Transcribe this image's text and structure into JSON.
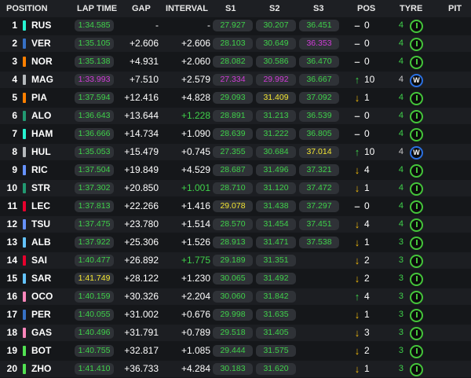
{
  "headers": {
    "position": "POSITION",
    "lap_time": "LAP TIME",
    "gap": "GAP",
    "interval": "INTERVAL",
    "s1": "S1",
    "s2": "S2",
    "s3": "S3",
    "pos": "POS",
    "tyre": "TYRE",
    "pit": "PIT"
  },
  "colors": {
    "personal_best": "#3fd14a",
    "session_best": "#d13cd8",
    "slower": "#f2e532",
    "medium_tyre": "#44c43a",
    "inter_tyre": "#2a6fe0"
  },
  "rows": [
    {
      "pos": "1",
      "team_color": "#27f4d2",
      "code": "RUS",
      "lap": "1:34.585",
      "lap_c": "green",
      "gap": "-",
      "int": "-",
      "int_c": "white",
      "s1": "27.927",
      "s1_c": "green",
      "s2": "30.207",
      "s2_c": "green",
      "s3": "36.451",
      "s3_c": "green",
      "arrow": "–",
      "arrow_dir": "none",
      "posval": "0",
      "tyre_life": "4",
      "tyre_icon": "medium-tyre-icon",
      "tyre_label": ""
    },
    {
      "pos": "2",
      "team_color": "#3671c6",
      "code": "VER",
      "lap": "1:35.105",
      "lap_c": "green",
      "gap": "+2.606",
      "int": "+2.606",
      "int_c": "white",
      "s1": "28.103",
      "s1_c": "green",
      "s2": "30.649",
      "s2_c": "green",
      "s3": "36.353",
      "s3_c": "purple",
      "arrow": "–",
      "arrow_dir": "none",
      "posval": "0",
      "tyre_life": "4",
      "tyre_icon": "medium-tyre-icon",
      "tyre_label": ""
    },
    {
      "pos": "3",
      "team_color": "#ff8000",
      "code": "NOR",
      "lap": "1:35.138",
      "lap_c": "green",
      "gap": "+4.931",
      "int": "+2.060",
      "int_c": "white",
      "s1": "28.082",
      "s1_c": "green",
      "s2": "30.586",
      "s2_c": "green",
      "s3": "36.470",
      "s3_c": "green",
      "arrow": "–",
      "arrow_dir": "none",
      "posval": "0",
      "tyre_life": "4",
      "tyre_icon": "medium-tyre-icon",
      "tyre_label": ""
    },
    {
      "pos": "4",
      "team_color": "#b6babd",
      "code": "MAG",
      "lap": "1:33.993",
      "lap_c": "purple",
      "gap": "+7.510",
      "int": "+2.579",
      "int_c": "white",
      "s1": "27.334",
      "s1_c": "purple",
      "s2": "29.992",
      "s2_c": "purple",
      "s3": "36.667",
      "s3_c": "green",
      "arrow": "↑",
      "arrow_dir": "up",
      "posval": "10",
      "tyre_life": "4",
      "tyre_icon": "intermediate-tyre-icon",
      "tyre_label": "W"
    },
    {
      "pos": "5",
      "team_color": "#ff8000",
      "code": "PIA",
      "lap": "1:37.594",
      "lap_c": "green",
      "gap": "+12.416",
      "int": "+4.828",
      "int_c": "white",
      "s1": "29.093",
      "s1_c": "green",
      "s2": "31.409",
      "s2_c": "yellow",
      "s3": "37.092",
      "s3_c": "green",
      "arrow": "↓",
      "arrow_dir": "down",
      "posval": "1",
      "tyre_life": "4",
      "tyre_icon": "medium-tyre-icon",
      "tyre_label": ""
    },
    {
      "pos": "6",
      "team_color": "#229971",
      "code": "ALO",
      "lap": "1:36.643",
      "lap_c": "green",
      "gap": "+13.644",
      "int": "+1.228",
      "int_c": "green",
      "s1": "28.891",
      "s1_c": "green",
      "s2": "31.213",
      "s2_c": "green",
      "s3": "36.539",
      "s3_c": "green",
      "arrow": "–",
      "arrow_dir": "none",
      "posval": "0",
      "tyre_life": "4",
      "tyre_icon": "medium-tyre-icon",
      "tyre_label": ""
    },
    {
      "pos": "7",
      "team_color": "#27f4d2",
      "code": "HAM",
      "lap": "1:36.666",
      "lap_c": "green",
      "gap": "+14.734",
      "int": "+1.090",
      "int_c": "white",
      "s1": "28.639",
      "s1_c": "green",
      "s2": "31.222",
      "s2_c": "green",
      "s3": "36.805",
      "s3_c": "green",
      "arrow": "–",
      "arrow_dir": "none",
      "posval": "0",
      "tyre_life": "4",
      "tyre_icon": "medium-tyre-icon",
      "tyre_label": ""
    },
    {
      "pos": "8",
      "team_color": "#b6babd",
      "code": "HUL",
      "lap": "1:35.053",
      "lap_c": "green",
      "gap": "+15.479",
      "int": "+0.745",
      "int_c": "white",
      "s1": "27.355",
      "s1_c": "green",
      "s2": "30.684",
      "s2_c": "green",
      "s3": "37.014",
      "s3_c": "yellow",
      "arrow": "↑",
      "arrow_dir": "up",
      "posval": "10",
      "tyre_life": "4",
      "tyre_icon": "intermediate-tyre-icon",
      "tyre_label": "W"
    },
    {
      "pos": "9",
      "team_color": "#6692ff",
      "code": "RIC",
      "lap": "1:37.504",
      "lap_c": "green",
      "gap": "+19.849",
      "int": "+4.529",
      "int_c": "white",
      "s1": "28.687",
      "s1_c": "green",
      "s2": "31.496",
      "s2_c": "green",
      "s3": "37.321",
      "s3_c": "green",
      "arrow": "↓",
      "arrow_dir": "down",
      "posval": "4",
      "tyre_life": "4",
      "tyre_icon": "medium-tyre-icon",
      "tyre_label": ""
    },
    {
      "pos": "10",
      "team_color": "#229971",
      "code": "STR",
      "lap": "1:37.302",
      "lap_c": "green",
      "gap": "+20.850",
      "int": "+1.001",
      "int_c": "green",
      "s1": "28.710",
      "s1_c": "green",
      "s2": "31.120",
      "s2_c": "green",
      "s3": "37.472",
      "s3_c": "green",
      "arrow": "↓",
      "arrow_dir": "down",
      "posval": "1",
      "tyre_life": "4",
      "tyre_icon": "medium-tyre-icon",
      "tyre_label": ""
    },
    {
      "pos": "11",
      "team_color": "#e8002d",
      "code": "LEC",
      "lap": "1:37.813",
      "lap_c": "green",
      "gap": "+22.266",
      "int": "+1.416",
      "int_c": "white",
      "s1": "29.078",
      "s1_c": "yellow",
      "s2": "31.438",
      "s2_c": "green",
      "s3": "37.297",
      "s3_c": "green",
      "arrow": "–",
      "arrow_dir": "none",
      "posval": "0",
      "tyre_life": "4",
      "tyre_icon": "medium-tyre-icon",
      "tyre_label": ""
    },
    {
      "pos": "12",
      "team_color": "#6692ff",
      "code": "TSU",
      "lap": "1:37.475",
      "lap_c": "green",
      "gap": "+23.780",
      "int": "+1.514",
      "int_c": "white",
      "s1": "28.570",
      "s1_c": "green",
      "s2": "31.454",
      "s2_c": "green",
      "s3": "37.451",
      "s3_c": "green",
      "arrow": "↓",
      "arrow_dir": "down",
      "posval": "4",
      "tyre_life": "4",
      "tyre_icon": "medium-tyre-icon",
      "tyre_label": ""
    },
    {
      "pos": "13",
      "team_color": "#64c4ff",
      "code": "ALB",
      "lap": "1:37.922",
      "lap_c": "green",
      "gap": "+25.306",
      "int": "+1.526",
      "int_c": "white",
      "s1": "28.913",
      "s1_c": "green",
      "s2": "31.471",
      "s2_c": "green",
      "s3": "37.538",
      "s3_c": "green",
      "arrow": "↓",
      "arrow_dir": "down",
      "posval": "1",
      "tyre_life": "3",
      "tyre_icon": "medium-tyre-icon",
      "tyre_label": ""
    },
    {
      "pos": "14",
      "team_color": "#e8002d",
      "code": "SAI",
      "lap": "1:40.477",
      "lap_c": "green",
      "gap": "+26.892",
      "int": "+1.775",
      "int_c": "green",
      "s1": "29.189",
      "s1_c": "green",
      "s2": "31.351",
      "s2_c": "green",
      "s3": "",
      "s3_c": "green",
      "arrow": "↓",
      "arrow_dir": "down",
      "posval": "2",
      "tyre_life": "3",
      "tyre_icon": "medium-tyre-icon",
      "tyre_label": ""
    },
    {
      "pos": "15",
      "team_color": "#64c4ff",
      "code": "SAR",
      "lap": "1:41.749",
      "lap_c": "yellow",
      "gap": "+28.122",
      "int": "+1.230",
      "int_c": "white",
      "s1": "30.065",
      "s1_c": "green",
      "s2": "31.492",
      "s2_c": "green",
      "s3": "",
      "s3_c": "green",
      "arrow": "↓",
      "arrow_dir": "down",
      "posval": "2",
      "tyre_life": "3",
      "tyre_icon": "medium-tyre-icon",
      "tyre_label": ""
    },
    {
      "pos": "16",
      "team_color": "#ff87bc",
      "code": "OCO",
      "lap": "1:40.159",
      "lap_c": "green",
      "gap": "+30.326",
      "int": "+2.204",
      "int_c": "white",
      "s1": "30.060",
      "s1_c": "green",
      "s2": "31.842",
      "s2_c": "green",
      "s3": "",
      "s3_c": "green",
      "arrow": "↑",
      "arrow_dir": "up",
      "posval": "4",
      "tyre_life": "3",
      "tyre_icon": "medium-tyre-icon",
      "tyre_label": ""
    },
    {
      "pos": "17",
      "team_color": "#3671c6",
      "code": "PER",
      "lap": "1:40.055",
      "lap_c": "green",
      "gap": "+31.002",
      "int": "+0.676",
      "int_c": "white",
      "s1": "29.998",
      "s1_c": "green",
      "s2": "31.635",
      "s2_c": "green",
      "s3": "",
      "s3_c": "green",
      "arrow": "↓",
      "arrow_dir": "down",
      "posval": "1",
      "tyre_life": "3",
      "tyre_icon": "medium-tyre-icon",
      "tyre_label": ""
    },
    {
      "pos": "18",
      "team_color": "#ff87bc",
      "code": "GAS",
      "lap": "1:40.496",
      "lap_c": "green",
      "gap": "+31.791",
      "int": "+0.789",
      "int_c": "white",
      "s1": "29.518",
      "s1_c": "green",
      "s2": "31.405",
      "s2_c": "green",
      "s3": "",
      "s3_c": "green",
      "arrow": "↓",
      "arrow_dir": "down",
      "posval": "3",
      "tyre_life": "3",
      "tyre_icon": "medium-tyre-icon",
      "tyre_label": ""
    },
    {
      "pos": "19",
      "team_color": "#52e252",
      "code": "BOT",
      "lap": "1:40.755",
      "lap_c": "green",
      "gap": "+32.817",
      "int": "+1.085",
      "int_c": "white",
      "s1": "29.444",
      "s1_c": "green",
      "s2": "31.575",
      "s2_c": "green",
      "s3": "",
      "s3_c": "green",
      "arrow": "↓",
      "arrow_dir": "down",
      "posval": "2",
      "tyre_life": "3",
      "tyre_icon": "medium-tyre-icon",
      "tyre_label": ""
    },
    {
      "pos": "20",
      "team_color": "#52e252",
      "code": "ZHO",
      "lap": "1:41.410",
      "lap_c": "green",
      "gap": "+36.733",
      "int": "+4.284",
      "int_c": "white",
      "s1": "30.183",
      "s1_c": "green",
      "s2": "31.620",
      "s2_c": "green",
      "s3": "",
      "s3_c": "green",
      "arrow": "↓",
      "arrow_dir": "down",
      "posval": "1",
      "tyre_life": "3",
      "tyre_icon": "medium-tyre-icon",
      "tyre_label": ""
    }
  ]
}
